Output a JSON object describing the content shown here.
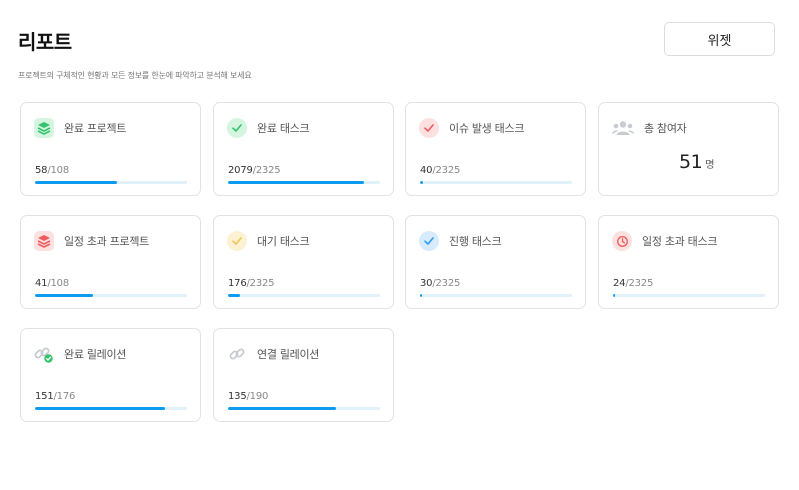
{
  "header": {
    "title": "리포트",
    "subtitle": "프로젝트의 구체적인 현황과 모든 정보를 한눈에 파악하고 분석해 보세요",
    "widget_button": "위젯"
  },
  "cards": [
    {
      "label": "완료 프로젝트",
      "icon": "stack-icon",
      "done": "58",
      "total": "/108",
      "ratio": 0.537,
      "color": "#34c26a",
      "bg": "#d6f5e1"
    },
    {
      "label": "완료 태스크",
      "icon": "check-icon",
      "done": "2079",
      "total": "/2325",
      "ratio": 0.894,
      "color": "#34c26a",
      "bg": "#d6f5e1"
    },
    {
      "label": "이슈 발생 태스크",
      "icon": "check-icon",
      "done": "40",
      "total": "/2325",
      "ratio": 0.017,
      "color": "#ef5c5c",
      "bg": "#fde0e0"
    },
    {
      "label": "총 참여자",
      "icon": "people-icon",
      "value": "51",
      "unit": "명",
      "color": "#c8ccd2"
    },
    {
      "label": "일정 초과 프로젝트",
      "icon": "stack-icon",
      "done": "41",
      "total": "/108",
      "ratio": 0.38,
      "color": "#ef5c5c",
      "bg": "#fde0e0"
    },
    {
      "label": "대기 태스크",
      "icon": "check-icon",
      "done": "176",
      "total": "/2325",
      "ratio": 0.076,
      "color": "#f2c35a",
      "bg": "#fdf1d4"
    },
    {
      "label": "진행 태스크",
      "icon": "check-icon",
      "done": "30",
      "total": "/2325",
      "ratio": 0.013,
      "color": "#2d9bf0",
      "bg": "#d7ebfc"
    },
    {
      "label": "일정 초과 태스크",
      "icon": "clock-icon",
      "done": "24",
      "total": "/2325",
      "ratio": 0.01,
      "color": "#ef5c5c",
      "bg": "#fde0e0"
    },
    {
      "label": "완료 릴레이션",
      "icon": "link-check-icon",
      "done": "151",
      "total": "/176",
      "ratio": 0.858,
      "color": "#34c26a",
      "bg": "#ffffff"
    },
    {
      "label": "연결 릴레이션",
      "icon": "link-icon",
      "done": "135",
      "total": "/190",
      "ratio": 0.71,
      "color": "#c8ccd2",
      "bg": "#ffffff"
    }
  ]
}
